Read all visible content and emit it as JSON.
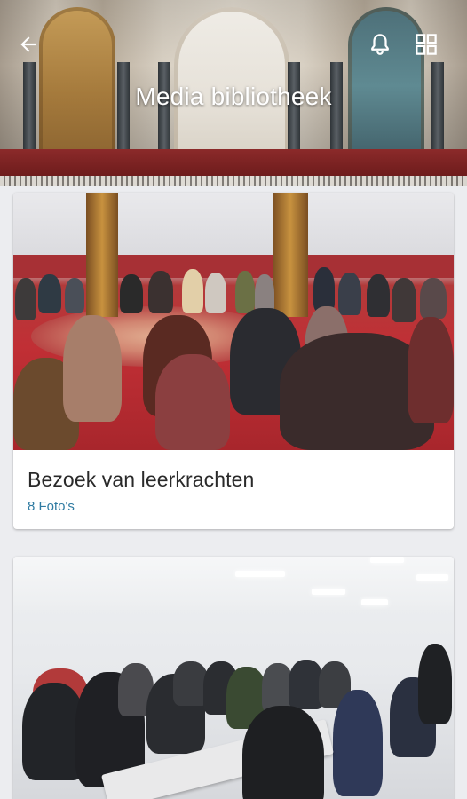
{
  "header": {
    "title": "Media bibliotheek",
    "icons": {
      "back": "arrow-back-icon",
      "notifications": "bell-icon",
      "view_toggle": "grid-view-icon"
    }
  },
  "albums": [
    {
      "title": "Bezoek van leerkrachten",
      "count_label": "8 Foto's"
    },
    {
      "title": "",
      "count_label": ""
    }
  ],
  "colors": {
    "background": "#ecedf0",
    "card": "#ffffff",
    "title_text": "#2a2a2a",
    "accent_link": "#2f7ba2",
    "header_text": "#ffffff"
  }
}
